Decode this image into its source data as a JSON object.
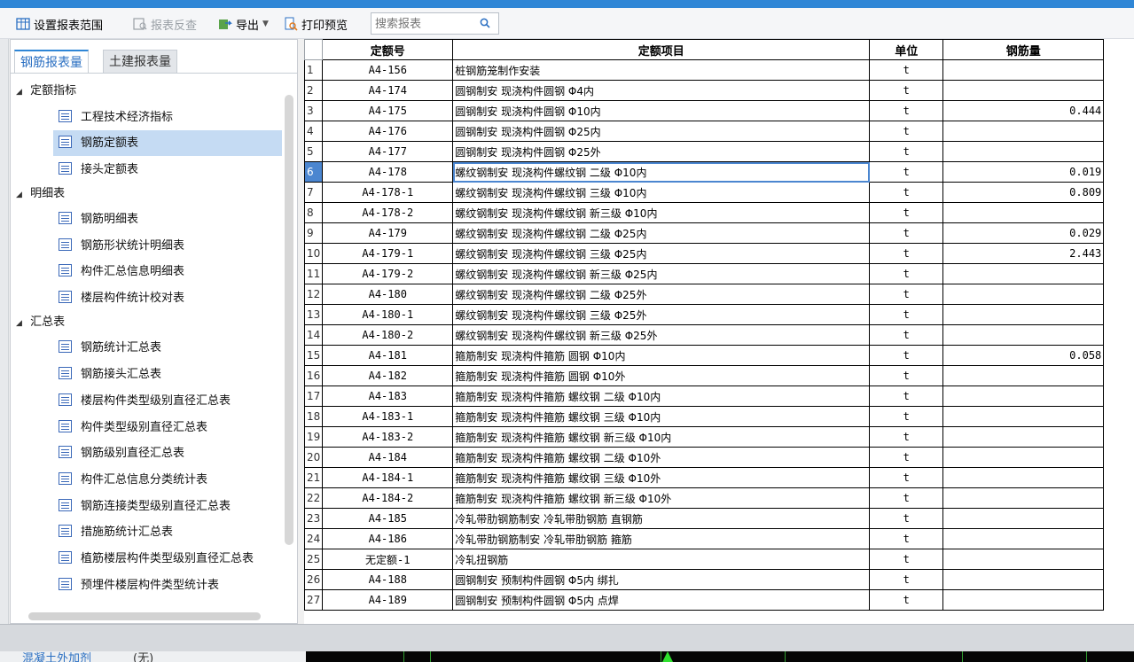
{
  "toolbar": {
    "set_range": "设置报表范围",
    "report_review": "报表反查",
    "export": "导出",
    "print_preview": "打印预览",
    "search_placeholder": "搜索报表"
  },
  "tabs": {
    "rebar": "钢筋报表量",
    "civil": "土建报表量"
  },
  "tree": {
    "group1": "定额指标",
    "g1_items": [
      "工程技术经济指标",
      "钢筋定额表",
      "接头定额表"
    ],
    "group2": "明细表",
    "g2_items": [
      "钢筋明细表",
      "钢筋形状统计明细表",
      "构件汇总信息明细表",
      "楼层构件统计校对表"
    ],
    "group3": "汇总表",
    "g3_items": [
      "钢筋统计汇总表",
      "钢筋接头汇总表",
      "楼层构件类型级别直径汇总表",
      "构件类型级别直径汇总表",
      "钢筋级别直径汇总表",
      "构件汇总信息分类统计表",
      "钢筋连接类型级别直径汇总表",
      "措施筋统计汇总表",
      "植筋楼层构件类型级别直径汇总表",
      "预埋件楼层构件类型统计表"
    ]
  },
  "grid": {
    "headers": [
      "定额号",
      "定额项目",
      "单位",
      "钢筋量"
    ],
    "rows": [
      {
        "n": "1",
        "code": "A4-156",
        "item": "桩钢筋笼制作安装",
        "unit": "t",
        "qty": ""
      },
      {
        "n": "2",
        "code": "A4-174",
        "item": "圆钢制安 现浇构件圆钢 Φ4内",
        "unit": "t",
        "qty": ""
      },
      {
        "n": "3",
        "code": "A4-175",
        "item": "圆钢制安 现浇构件圆钢 Φ10内",
        "unit": "t",
        "qty": "0.444"
      },
      {
        "n": "4",
        "code": "A4-176",
        "item": "圆钢制安 现浇构件圆钢 Φ25内",
        "unit": "t",
        "qty": ""
      },
      {
        "n": "5",
        "code": "A4-177",
        "item": "圆钢制安 现浇构件圆钢 Φ25外",
        "unit": "t",
        "qty": ""
      },
      {
        "n": "6",
        "code": "A4-178",
        "item": "螺纹钢制安 现浇构件螺纹钢 二级 Φ10内",
        "unit": "t",
        "qty": "0.019"
      },
      {
        "n": "7",
        "code": "A4-178-1",
        "item": "螺纹钢制安 现浇构件螺纹钢 三级 Φ10内",
        "unit": "t",
        "qty": "0.809"
      },
      {
        "n": "8",
        "code": "A4-178-2",
        "item": "螺纹钢制安 现浇构件螺纹钢 新三级 Φ10内",
        "unit": "t",
        "qty": ""
      },
      {
        "n": "9",
        "code": "A4-179",
        "item": "螺纹钢制安 现浇构件螺纹钢 二级 Φ25内",
        "unit": "t",
        "qty": "0.029"
      },
      {
        "n": "10",
        "code": "A4-179-1",
        "item": "螺纹钢制安 现浇构件螺纹钢 三级 Φ25内",
        "unit": "t",
        "qty": "2.443"
      },
      {
        "n": "11",
        "code": "A4-179-2",
        "item": "螺纹钢制安 现浇构件螺纹钢 新三级 Φ25内",
        "unit": "t",
        "qty": ""
      },
      {
        "n": "12",
        "code": "A4-180",
        "item": "螺纹钢制安 现浇构件螺纹钢 二级 Φ25外",
        "unit": "t",
        "qty": ""
      },
      {
        "n": "13",
        "code": "A4-180-1",
        "item": "螺纹钢制安 现浇构件螺纹钢 三级 Φ25外",
        "unit": "t",
        "qty": ""
      },
      {
        "n": "14",
        "code": "A4-180-2",
        "item": "螺纹钢制安 现浇构件螺纹钢 新三级 Φ25外",
        "unit": "t",
        "qty": ""
      },
      {
        "n": "15",
        "code": "A4-181",
        "item": "箍筋制安 现浇构件箍筋 圆钢 Φ10内",
        "unit": "t",
        "qty": "0.058"
      },
      {
        "n": "16",
        "code": "A4-182",
        "item": "箍筋制安 现浇构件箍筋 圆钢 Φ10外",
        "unit": "t",
        "qty": ""
      },
      {
        "n": "17",
        "code": "A4-183",
        "item": "箍筋制安 现浇构件箍筋 螺纹钢 二级 Φ10内",
        "unit": "t",
        "qty": ""
      },
      {
        "n": "18",
        "code": "A4-183-1",
        "item": "箍筋制安 现浇构件箍筋 螺纹钢  三级 Φ10内",
        "unit": "t",
        "qty": ""
      },
      {
        "n": "19",
        "code": "A4-183-2",
        "item": "箍筋制安 现浇构件箍筋 螺纹钢  新三级 Φ10内",
        "unit": "t",
        "qty": ""
      },
      {
        "n": "20",
        "code": "A4-184",
        "item": "箍筋制安 现浇构件箍筋 螺纹钢 二级 Φ10外",
        "unit": "t",
        "qty": ""
      },
      {
        "n": "21",
        "code": "A4-184-1",
        "item": "箍筋制安 现浇构件箍筋 螺纹钢 三级 Φ10外",
        "unit": "t",
        "qty": ""
      },
      {
        "n": "22",
        "code": "A4-184-2",
        "item": "箍筋制安 现浇构件箍筋 螺纹钢 新三级 Φ10外",
        "unit": "t",
        "qty": ""
      },
      {
        "n": "23",
        "code": "A4-185",
        "item": "冷轧带肋钢筋制安 冷轧带肋钢筋 直钢筋",
        "unit": "t",
        "qty": ""
      },
      {
        "n": "24",
        "code": "A4-186",
        "item": "冷轧带肋钢筋制安 冷轧带肋钢筋 箍筋",
        "unit": "t",
        "qty": ""
      },
      {
        "n": "25",
        "code": "无定额-1",
        "item": "冷轧扭钢筋",
        "unit": "t",
        "qty": ""
      },
      {
        "n": "26",
        "code": "A4-188",
        "item": "圆钢制安 预制构件圆钢 Φ5内 绑扎",
        "unit": "t",
        "qty": ""
      },
      {
        "n": "27",
        "code": "A4-189",
        "item": "圆钢制安 预制构件圆钢 Φ5内 点焊",
        "unit": "t",
        "qty": ""
      }
    ],
    "active_row": 6
  },
  "status": {
    "left_text": "混凝土外加剂",
    "right_text": "(无)"
  },
  "colors": {
    "accent": "#2f86d6",
    "selection": "#c5dbf3",
    "active_row": "#4b86d0"
  }
}
